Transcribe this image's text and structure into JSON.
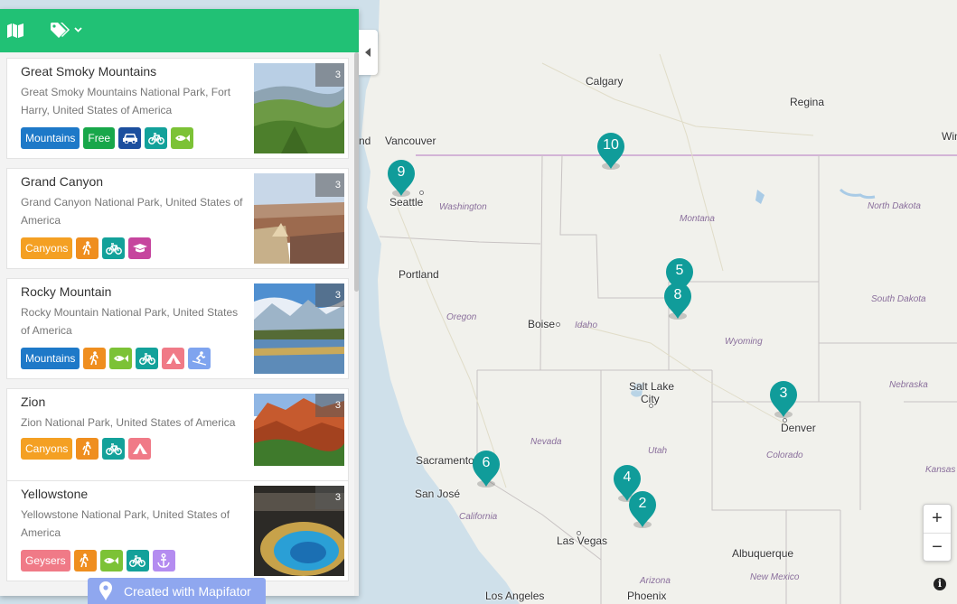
{
  "map": {
    "cities": [
      {
        "name": "Calgary"
      },
      {
        "name": "Regina"
      },
      {
        "name": "Win"
      },
      {
        "name": "Vancouver"
      },
      {
        "name": "nd"
      },
      {
        "name": "Seattle"
      },
      {
        "name": "Portland"
      },
      {
        "name": "Boise"
      },
      {
        "name": "Salt Lake"
      },
      {
        "name": "City"
      },
      {
        "name": "Denver"
      },
      {
        "name": "Sacramento"
      },
      {
        "name": "San José"
      },
      {
        "name": "Las Vegas"
      },
      {
        "name": "Albuquerque"
      },
      {
        "name": "Los Angeles"
      },
      {
        "name": "Phoenix"
      }
    ],
    "states": [
      "Washington",
      "Montana",
      "North Dakota",
      "South Dakota",
      "Oregon",
      "Idaho",
      "Wyoming",
      "Nebraska",
      "Nevada",
      "Utah",
      "Colorado",
      "Kansas",
      "California",
      "Arizona",
      "New Mexico"
    ],
    "markers": [
      "10",
      "9",
      "5",
      "8",
      "3",
      "6",
      "4",
      "2"
    ],
    "marker_color": "#109c9a",
    "zoom_in": "+",
    "zoom_out": "−",
    "info": "i"
  },
  "sidebar": {
    "header_color": "#21c175",
    "icons": [
      "map-icon",
      "tags-icon",
      "chevron-down-icon"
    ],
    "parks": [
      {
        "title": "Great Smoky Mountains",
        "address": "Great Smoky Mountains National Park, Fort Harry, United States of America",
        "count": "3",
        "tags": [
          {
            "label": "Mountains",
            "color": "#1e79c8"
          },
          {
            "label": "Free",
            "color": "#18a74a"
          },
          {
            "icon": "car-icon",
            "color": "#1c4f9e"
          },
          {
            "icon": "bicycle-icon",
            "color": "#13a19a"
          },
          {
            "icon": "fish-icon",
            "color": "#7cc236"
          }
        ]
      },
      {
        "title": "Grand Canyon",
        "address": "Grand Canyon National Park, United States of America",
        "count": "3",
        "tags": [
          {
            "label": "Canyons",
            "color": "#f4a023"
          },
          {
            "icon": "hiking-icon",
            "color": "#ef8e1f"
          },
          {
            "icon": "bicycle-icon",
            "color": "#13a19a"
          },
          {
            "icon": "graduation-cap-icon",
            "color": "#c6459e"
          }
        ]
      },
      {
        "title": "Rocky Mountain",
        "address": "Rocky Mountain National Park, United States of America",
        "count": "3",
        "tags": [
          {
            "label": "Mountains",
            "color": "#1e79c8"
          },
          {
            "icon": "hiking-icon",
            "color": "#ef8e1f"
          },
          {
            "icon": "fish-icon",
            "color": "#7cc236"
          },
          {
            "icon": "bicycle-icon",
            "color": "#13a19a"
          },
          {
            "icon": "camping-icon",
            "color": "#f07a87"
          },
          {
            "icon": "skiing-icon",
            "color": "#7fa4ef"
          }
        ]
      },
      {
        "title": "Zion",
        "address": "Zion National Park, United States of America",
        "count": "3",
        "tags": [
          {
            "label": "Canyons",
            "color": "#f4a023"
          },
          {
            "icon": "hiking-icon",
            "color": "#ef8e1f"
          },
          {
            "icon": "bicycle-icon",
            "color": "#13a19a"
          },
          {
            "icon": "camping-icon",
            "color": "#f07a87"
          }
        ]
      },
      {
        "title": "Yellowstone",
        "address": "Yellowstone National Park, United States of America",
        "count": "3",
        "tags": [
          {
            "label": "Geysers",
            "color": "#f07a87"
          },
          {
            "icon": "hiking-icon",
            "color": "#ef8e1f"
          },
          {
            "icon": "fish-icon",
            "color": "#7cc236"
          },
          {
            "icon": "bicycle-icon",
            "color": "#13a19a"
          },
          {
            "icon": "anchor-icon",
            "color": "#b48cf0"
          }
        ]
      }
    ],
    "created_with": "Created with Mapifator"
  }
}
